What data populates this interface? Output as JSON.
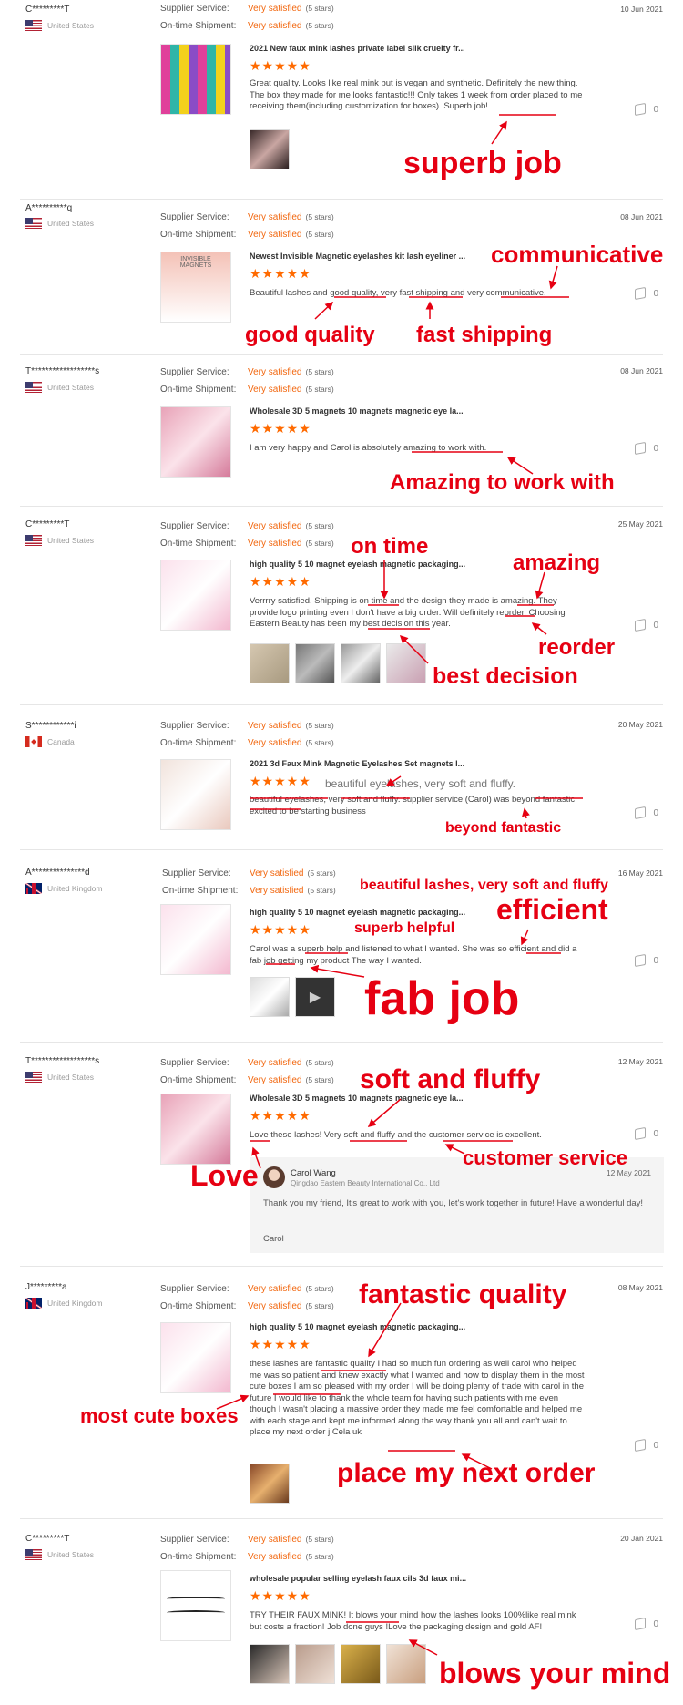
{
  "labels": {
    "supplier_service": "Supplier Service:",
    "on_time_shipment": "On-time Shipment:"
  },
  "reviews": [
    {
      "name": "C*********T",
      "country": "United States",
      "service": "Very satisfied",
      "service_stars": "(5 stars)",
      "shipment": "Very satisfied",
      "shipment_stars": "(5 stars)",
      "date": "10 Jun 2021",
      "product": "2021 New faux mink lashes private label silk cruelty fr...",
      "rating": "★★★★★",
      "text": "Great quality. Looks like real mink but is vegan and synthetic. Definitely the new thing. The box they made for me looks fantastic!!! Only takes 1 week from order placed to me receiving them(including customization for boxes). Superb job!",
      "likes": "0"
    },
    {
      "name": "A**********q",
      "country": "United States",
      "service": "Very satisfied",
      "service_stars": "(5 stars)",
      "shipment": "Very satisfied",
      "shipment_stars": "(5 stars)",
      "date": "08 Jun 2021",
      "product": "Newest Invisible Magnetic eyelashes kit lash eyeliner ...",
      "rating": "★★★★★",
      "text": "Beautiful lashes and good quality, very fast shipping and very communicative.",
      "likes": "0",
      "thumb_caption": "INVISIBLE MAGNETS"
    },
    {
      "name": "T******************s",
      "country": "United States",
      "service": "Very satisfied",
      "service_stars": "(5 stars)",
      "shipment": "Very satisfied",
      "shipment_stars": "(5 stars)",
      "date": "08 Jun 2021",
      "product": "Wholesale 3D 5 magnets 10 magnets magnetic eye la...",
      "rating": "★★★★★",
      "text": "I am very happy and Carol is absolutely amazing to work with.",
      "likes": "0"
    },
    {
      "name": "C*********T",
      "country": "United States",
      "service": "Very satisfied",
      "service_stars": "(5 stars)",
      "shipment": "Very satisfied",
      "shipment_stars": "(5 stars)",
      "date": "25 May 2021",
      "product": "high quality 5 10 magnet eyelash magnetic packaging...",
      "rating": "★★★★★",
      "text": "Verrrry satisfied. Shipping is on time and the design they made is amazing. They provide logo printing even I don't have a big order. Will definitely reorder. Choosing Eastern Beauty has been my best decision this year.",
      "likes": "0"
    },
    {
      "name": "S************i",
      "country": "Canada",
      "service": "Very satisfied",
      "service_stars": "(5 stars)",
      "shipment": "Very satisfied",
      "shipment_stars": "(5 stars)",
      "date": "20 May 2021",
      "product": "2021 3d Faux Mink Magnetic Eyelashes Set magnets l...",
      "rating": "★★★★★",
      "text": "beautiful eyelashes, very soft and fluffy.  supplier service (Carol) was beyond fantastic.  excited to be starting business",
      "likes": "0"
    },
    {
      "name": "A***************d",
      "country": "United Kingdom",
      "service": "Very satisfied",
      "service_stars": "(5 stars)",
      "shipment": "Very satisfied",
      "shipment_stars": "(5 stars)",
      "date": "16 May 2021",
      "product": "high quality 5 10 magnet eyelash magnetic packaging...",
      "rating": "★★★★★",
      "text": "Carol was a superb help and listened to what I wanted. She was so efficient and did a fab job getting my product The way I wanted.",
      "likes": "0"
    },
    {
      "name": "T******************s",
      "country": "United States",
      "service": "Very satisfied",
      "service_stars": "(5 stars)",
      "shipment": "Very satisfied",
      "shipment_stars": "(5 stars)",
      "date": "12 May 2021",
      "product": "Wholesale 3D 5 magnets 10 magnets magnetic eye la...",
      "rating": "★★★★★",
      "text": "Love these lashes! Very soft and fluffy and the customer service is excellent.",
      "likes": "0"
    },
    {
      "name": "J*********a",
      "country": "United Kingdom",
      "service": "Very satisfied",
      "service_stars": "(5 stars)",
      "shipment": "Very satisfied",
      "shipment_stars": "(5 stars)",
      "date": "08 May 2021",
      "product": "high quality 5 10 magnet eyelash magnetic packaging...",
      "rating": "★★★★★",
      "text": "these lashes are fantastic quality I had so much fun ordering as well carol who helped me was so patient and knew exactly what I wanted and how to display them in the most cute boxes I am so pleased with my order I will be doing plenty of trade with carol in the future I would like to thank the whole team for having such patients with me even though I wasn't placing a massive order they made me feel comfortable and helped me with each stage and kept me informed along the way thank you all and can't wait to place my next order j Cela uk",
      "likes": "0"
    },
    {
      "name": "C*********T",
      "country": "United States",
      "service": "Very satisfied",
      "service_stars": "(5 stars)",
      "shipment": "Very satisfied",
      "shipment_stars": "(5 stars)",
      "date": "20 Jan 2021",
      "product": "wholesale popular selling eyelash faux cils 3d faux mi...",
      "rating": "★★★★★",
      "text": "TRY THEIR FAUX MINK! It blows your mind how the lashes looks 100%like real mink but costs a fraction! Job done guys !Love the packaging design and gold AF!",
      "likes": "0"
    }
  ],
  "reply": {
    "name": "Carol Wang",
    "company": "Qingdao Eastern Beauty International Co., Ltd",
    "date": "12 May 2021",
    "text": "Thank you my friend,   It's great to work with you, let's work together in future! Have a wonderful day!",
    "sign": "Carol"
  },
  "annotations": {
    "superb_job": "superb job",
    "communicative": "communicative",
    "good_quality": "good quality",
    "fast_shipping": "fast shipping",
    "amazing_to_work_with": "Amazing to work with",
    "on_time": "on time",
    "amazing": "amazing",
    "reorder": "reorder",
    "best_decision": "best decision",
    "beautiful_eyelashes": "beautiful eyelashes, very soft and fluffy.",
    "beyond_fantastic": "beyond fantastic",
    "beautiful_lashes": "beautiful lashes, very soft and fluffy",
    "efficient": "efficient",
    "superb_helpful": "superb helpful",
    "fab_job": "fab job",
    "soft_and_fluffy": "soft and fluffy",
    "customer_service": "customer service",
    "love": "Love",
    "fantastic_quality": "fantastic quality",
    "most_cute_boxes": "most cute boxes",
    "place_my_next_order": "place my next order",
    "blows_your_mind": "blows your mind"
  },
  "colors": {
    "accent": "#f2670f",
    "annotation": "#e60012",
    "star": "#ff6a00"
  }
}
